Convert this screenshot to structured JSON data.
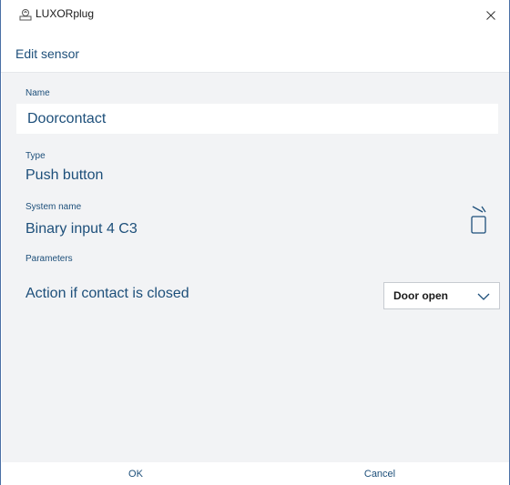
{
  "window": {
    "title": "LUXORplug",
    "app_icon": "luxorplug-app-icon",
    "close_icon": "close-icon"
  },
  "header": {
    "title": "Edit sensor"
  },
  "form": {
    "name_label": "Name",
    "name_value": "Doorcontact",
    "type_label": "Type",
    "type_value": "Push button",
    "system_name_label": "System name",
    "system_name_value": "Binary input 4 C3",
    "system_name_icon": "copy-to-name-icon",
    "parameters_label": "Parameters",
    "action_label": "Action if contact is closed",
    "action_value": "Door open",
    "action_dropdown_icon": "chevron-down-icon"
  },
  "footer": {
    "ok_label": "OK",
    "cancel_label": "Cancel"
  },
  "colors": {
    "accent": "#1d4f7a",
    "content_bg": "#f2f3f5",
    "window_border": "#4a6fa5"
  }
}
